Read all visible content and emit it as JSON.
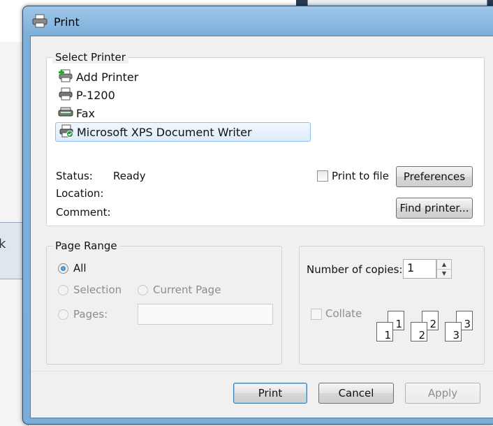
{
  "dialog": {
    "title": "Print"
  },
  "select_printer": {
    "label": "Select Printer",
    "printers": [
      {
        "name": "Add Printer",
        "icon": "add-printer-icon",
        "selected": false
      },
      {
        "name": "P-1200",
        "icon": "printer-icon",
        "selected": false
      },
      {
        "name": "Fax",
        "icon": "fax-icon",
        "selected": false
      },
      {
        "name": "Microsoft XPS Document Writer",
        "icon": "xps-printer-icon",
        "selected": true
      }
    ],
    "status_label": "Status:",
    "status_value": "Ready",
    "location_label": "Location:",
    "comment_label": "Comment:",
    "print_to_file_label": "Print to file",
    "preferences_label": "Preferences",
    "find_printer_label": "Find printer..."
  },
  "page_range": {
    "label": "Page Range",
    "all_label": "All",
    "selection_label": "Selection",
    "current_page_label": "Current Page",
    "pages_label": "Pages:",
    "pages_value": ""
  },
  "copies": {
    "number_label": "Number of copies:",
    "number_value": "1",
    "collate_label": "Collate",
    "collate_pages": [
      "1",
      "1",
      "2",
      "2",
      "3",
      "3"
    ]
  },
  "footer": {
    "print_label": "Print",
    "cancel_label": "Cancel",
    "apply_label": "Apply"
  },
  "colors": {
    "frame": "#7fb0db",
    "selection": "#dcebfc",
    "default_button_border": "#3c7fb1"
  }
}
